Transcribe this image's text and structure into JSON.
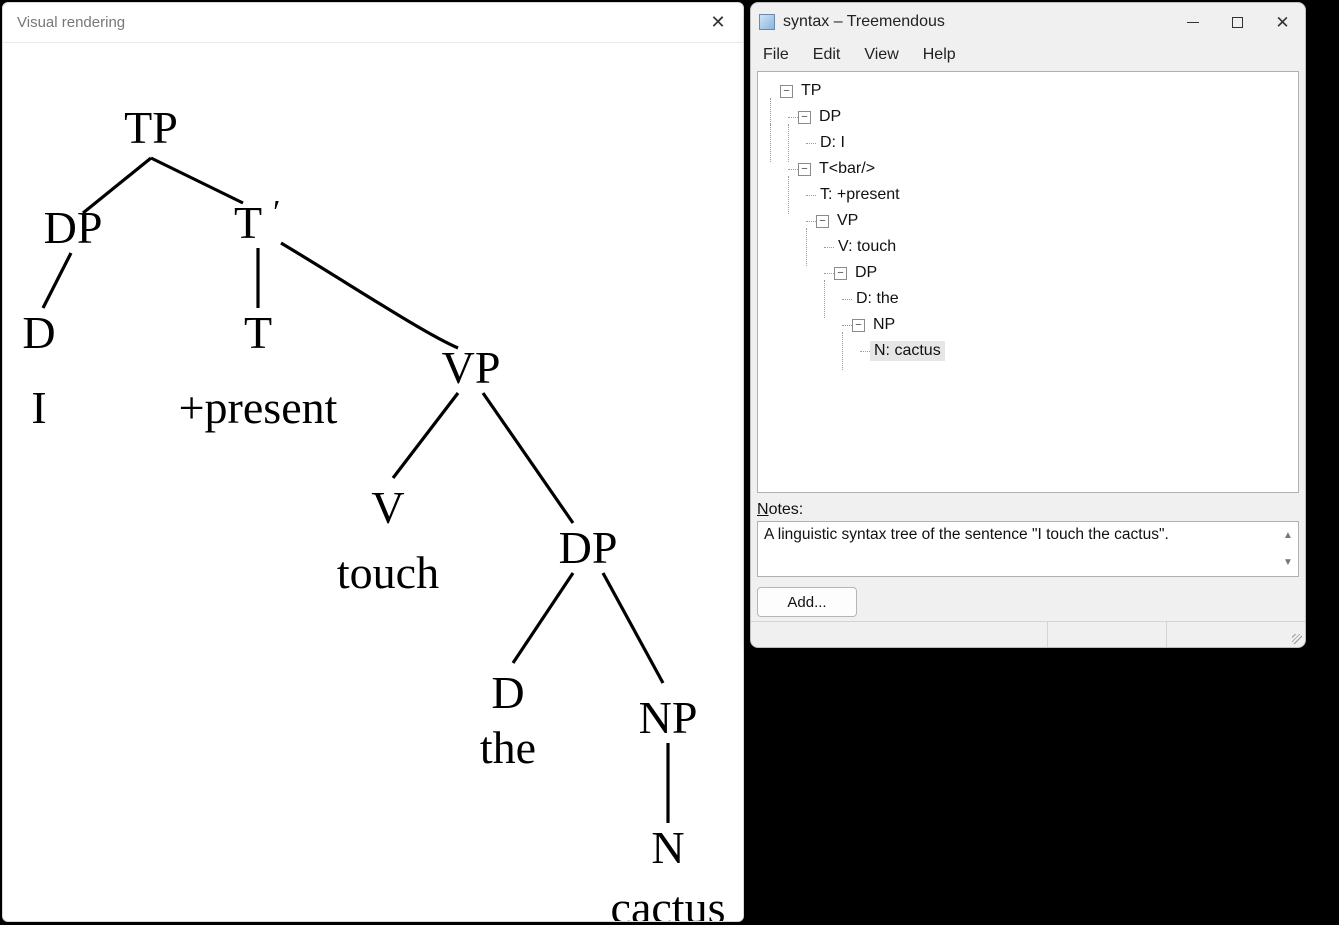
{
  "left_window": {
    "title": "Visual rendering",
    "tree": {
      "TP": {
        "label": "TP"
      },
      "DP1": {
        "label": "DP"
      },
      "D1": {
        "label": "D"
      },
      "I": {
        "label": "I"
      },
      "Tbar": {
        "label": "T",
        "sup": "′"
      },
      "T": {
        "label": "T"
      },
      "pres": {
        "label": "+present"
      },
      "VP": {
        "label": "VP"
      },
      "V": {
        "label": "V"
      },
      "touch": {
        "label": "touch"
      },
      "DP2": {
        "label": "DP"
      },
      "D2": {
        "label": "D"
      },
      "the": {
        "label": "the"
      },
      "NP": {
        "label": "NP"
      },
      "N": {
        "label": "N"
      },
      "cactus": {
        "label": "cactus"
      }
    }
  },
  "right_window": {
    "title": "syntax – Treemendous",
    "menu": {
      "file": "File",
      "edit": "Edit",
      "view": "View",
      "help": "Help"
    },
    "tree_nodes": {
      "n0": "TP",
      "n1": "DP",
      "n2": "D: I",
      "n3": "T<bar/>",
      "n4": "T: +present",
      "n5": "VP",
      "n6": "V: touch",
      "n7": "DP",
      "n8": "D: the",
      "n9": "NP",
      "n10": "N: cactus"
    },
    "notes_label_prefix": "N",
    "notes_label_rest": "otes:",
    "notes_text": "A linguistic syntax tree of the sentence \"I touch the cactus\".",
    "add_button": "Add..."
  }
}
